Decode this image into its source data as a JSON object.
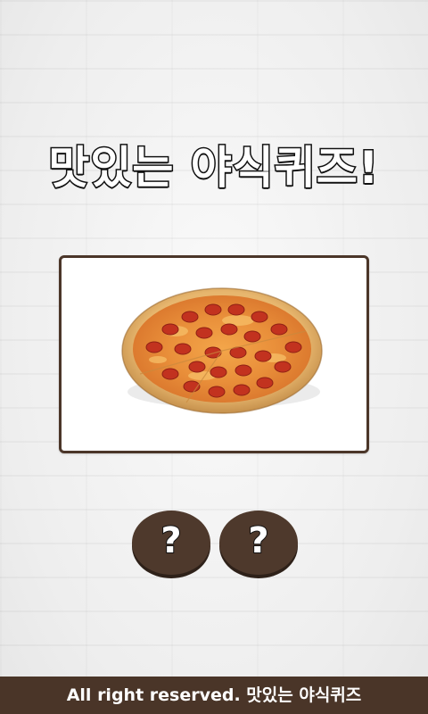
{
  "app": {
    "title": "맛있는 야식퀴즈!"
  },
  "question": {
    "image_icon": "pepperoni-pizza"
  },
  "answers": [
    {
      "label": "?"
    },
    {
      "label": "?"
    }
  ],
  "footer": {
    "text": "All right reserved. 맛있는 야식퀴즈"
  },
  "colors": {
    "accent_brown": "#4a3528",
    "frame_border": "#4b3629",
    "title_fill": "#ffffff",
    "title_stroke": "#111111"
  }
}
